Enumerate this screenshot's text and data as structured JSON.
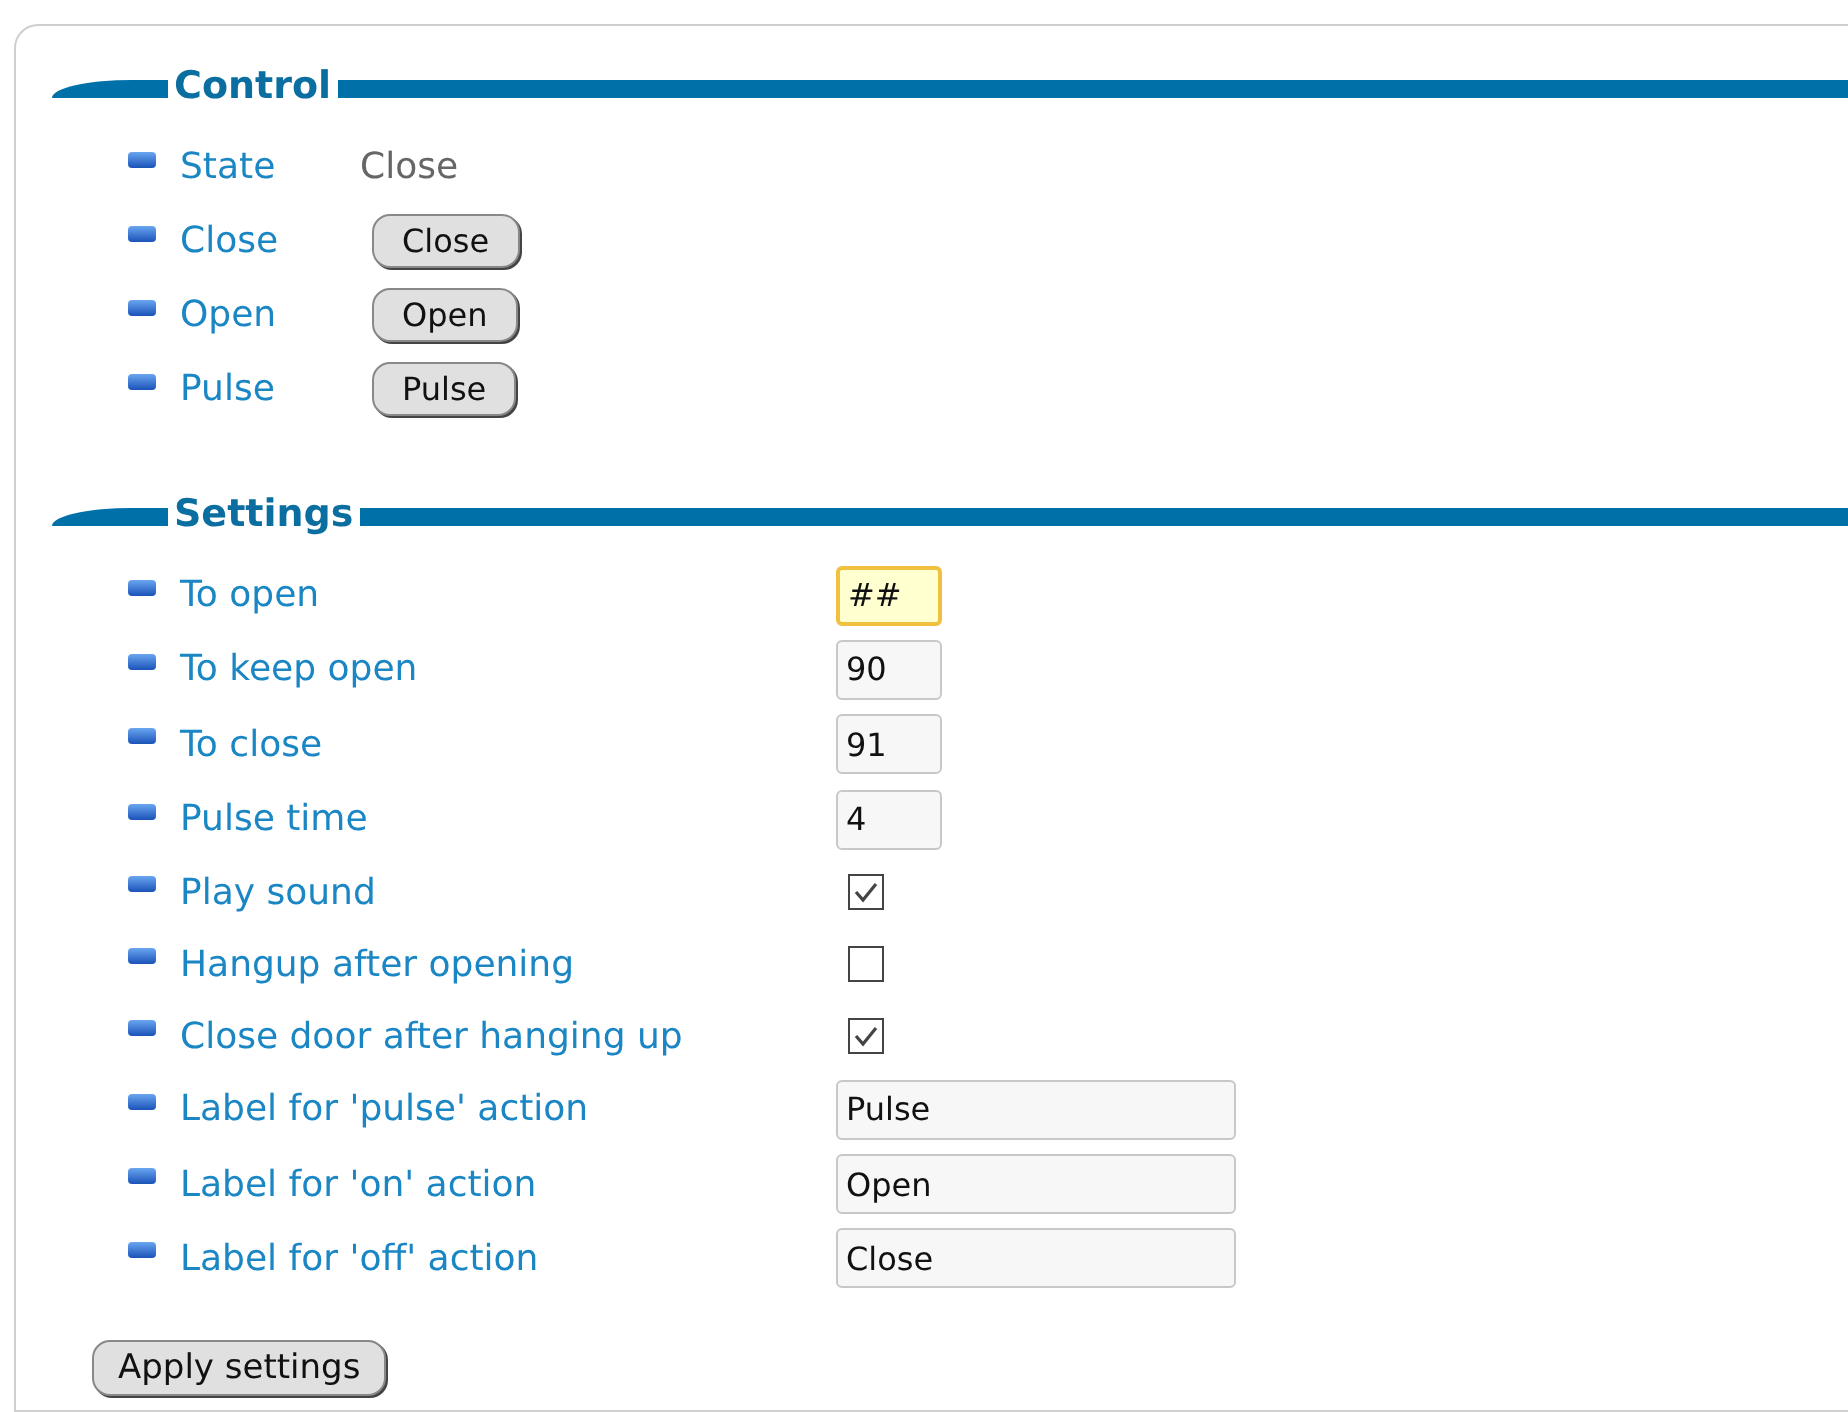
{
  "sections": [
    {
      "title": "Control",
      "rows": [
        {
          "label": "State",
          "kind": "text",
          "value": "Close"
        },
        {
          "label": "Close",
          "kind": "button",
          "value": "Close"
        },
        {
          "label": "Open",
          "kind": "button",
          "value": "Open"
        },
        {
          "label": "Pulse",
          "kind": "button",
          "value": "Pulse"
        }
      ]
    },
    {
      "title": "Settings",
      "rows": [
        {
          "label": "To open",
          "kind": "short_input",
          "value": "##",
          "focused": true
        },
        {
          "label": "To keep open",
          "kind": "short_input",
          "value": "90",
          "focused": false
        },
        {
          "label": "To close",
          "kind": "short_input",
          "value": "91",
          "focused": false
        },
        {
          "label": "Pulse time",
          "kind": "short_input",
          "value": "4",
          "focused": false
        },
        {
          "label": "Play sound",
          "kind": "checkbox",
          "checked": true
        },
        {
          "label": "Hangup after opening",
          "kind": "checkbox",
          "checked": false
        },
        {
          "label": "Close door after hanging up",
          "kind": "checkbox",
          "checked": true
        },
        {
          "label": "Label for 'pulse' action",
          "kind": "long_input",
          "value": "Pulse",
          "focused": false
        },
        {
          "label": "Label for 'on' action",
          "kind": "long_input",
          "value": "Open",
          "focused": false
        },
        {
          "label": "Label for 'off' action",
          "kind": "long_input",
          "value": "Close",
          "focused": false
        }
      ]
    }
  ],
  "apply_button": "Apply settings"
}
